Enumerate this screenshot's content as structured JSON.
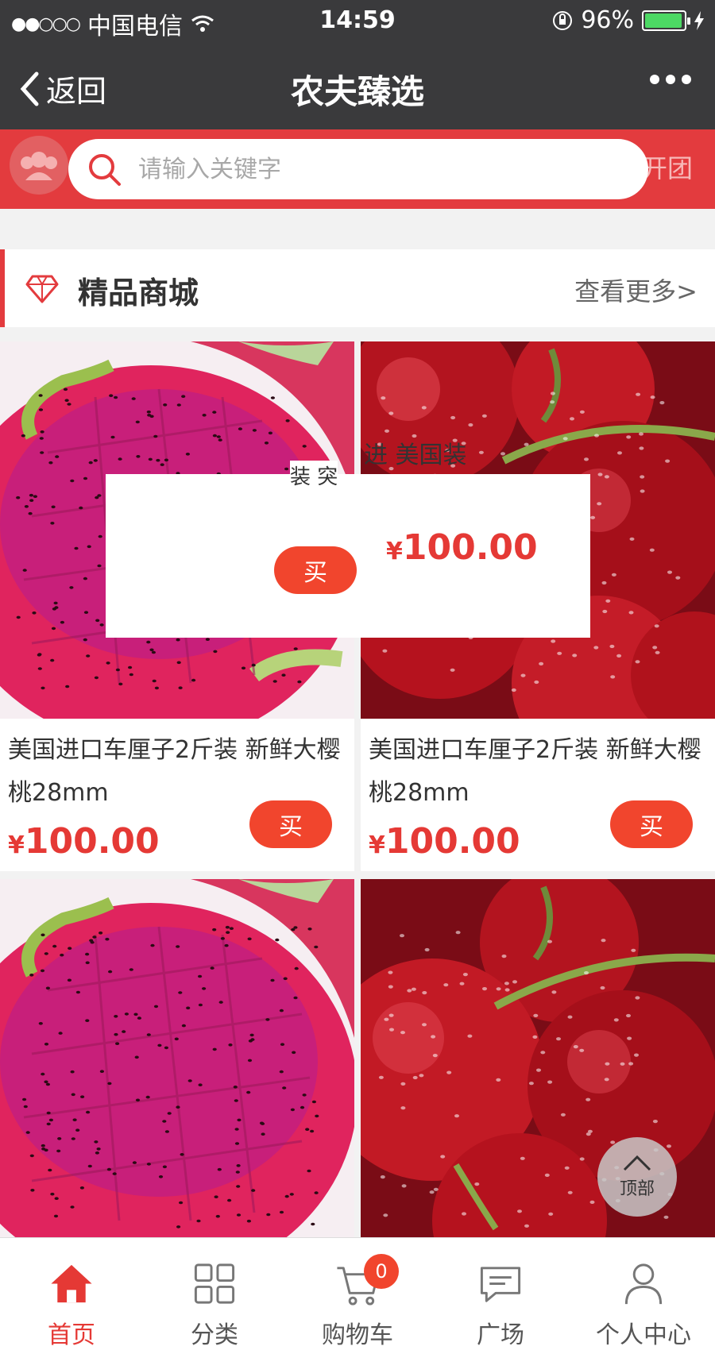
{
  "status_bar": {
    "signal": "●●○○○",
    "carrier": "中国电信",
    "time": "14:59",
    "battery": "96%",
    "battery_level": 0.96
  },
  "nav": {
    "back_label": "返回",
    "title": "农夫臻选"
  },
  "search": {
    "placeholder": "请输入关键字",
    "side_label": "开团"
  },
  "section": {
    "title": "精品商城",
    "more": "查看更多>"
  },
  "products": [
    {
      "name": "美国进口车厘子2斤装 新鲜大樱桃28mm",
      "price": "100.00",
      "currency": "¥",
      "buy": "买"
    },
    {
      "name": "美国进口车厘子2斤装 新鲜大樱桃28mm",
      "price": "100.00",
      "currency": "¥",
      "buy": "买"
    },
    {
      "name": "",
      "price": "",
      "currency": "",
      "buy": ""
    },
    {
      "name": "",
      "price": "",
      "currency": "",
      "buy": ""
    }
  ],
  "overlay": {
    "price": "100.00",
    "currency": "¥",
    "buy": "买",
    "text_fragment_1": "装 突",
    "text_fragment_2": "进 美国装"
  },
  "to_top": {
    "label": "顶部"
  },
  "tabbar": {
    "items": [
      {
        "label": "首页",
        "icon": "home-icon",
        "active": true
      },
      {
        "label": "分类",
        "icon": "grid-icon",
        "active": false
      },
      {
        "label": "购物车",
        "icon": "cart-icon",
        "active": false,
        "badge": "0"
      },
      {
        "label": "广场",
        "icon": "chat-icon",
        "active": false
      },
      {
        "label": "个人中心",
        "icon": "user-icon",
        "active": false
      }
    ]
  },
  "colors": {
    "accent": "#e33b3e",
    "price": "#e53935",
    "nav_bg": "#3a3a3c"
  }
}
